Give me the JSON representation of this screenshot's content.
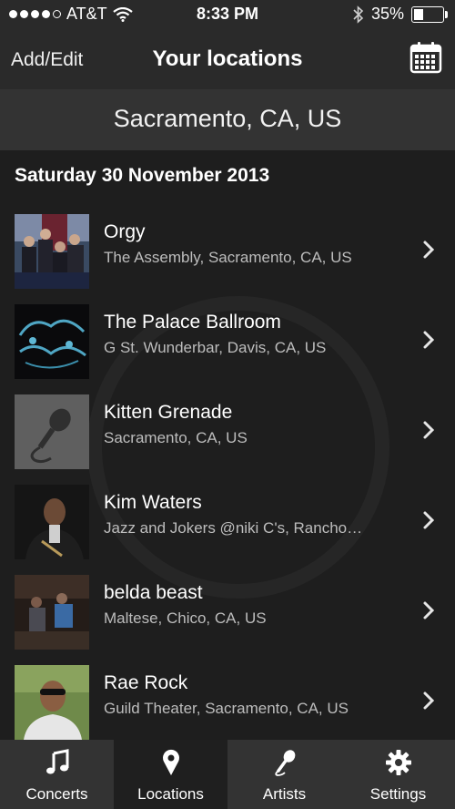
{
  "status_bar": {
    "carrier": "AT&T",
    "time": "8:33 PM",
    "battery": "35%"
  },
  "nav": {
    "left_label": "Add/Edit",
    "title": "Your locations"
  },
  "location": "Sacramento, CA, US",
  "list": {
    "date": "Saturday 30 November 2013",
    "items": [
      {
        "title": "Orgy",
        "subtitle": "The Assembly, Sacramento, CA, US"
      },
      {
        "title": "The Palace Ballroom",
        "subtitle": "G St. Wunderbar, Davis, CA, US"
      },
      {
        "title": "Kitten Grenade",
        "subtitle": "Sacramento, CA, US"
      },
      {
        "title": "Kim Waters",
        "subtitle": "Jazz and Jokers @niki C's, Rancho…"
      },
      {
        "title": "belda beast",
        "subtitle": "Maltese, Chico, CA, US"
      },
      {
        "title": "Rae Rock",
        "subtitle": "Guild Theater, Sacramento, CA, US"
      }
    ]
  },
  "tabs": [
    {
      "label": "Concerts",
      "icon": "music-note-icon"
    },
    {
      "label": "Locations",
      "icon": "location-pin-icon",
      "active": true
    },
    {
      "label": "Artists",
      "icon": "microphone-icon"
    },
    {
      "label": "Settings",
      "icon": "gear-icon"
    }
  ]
}
